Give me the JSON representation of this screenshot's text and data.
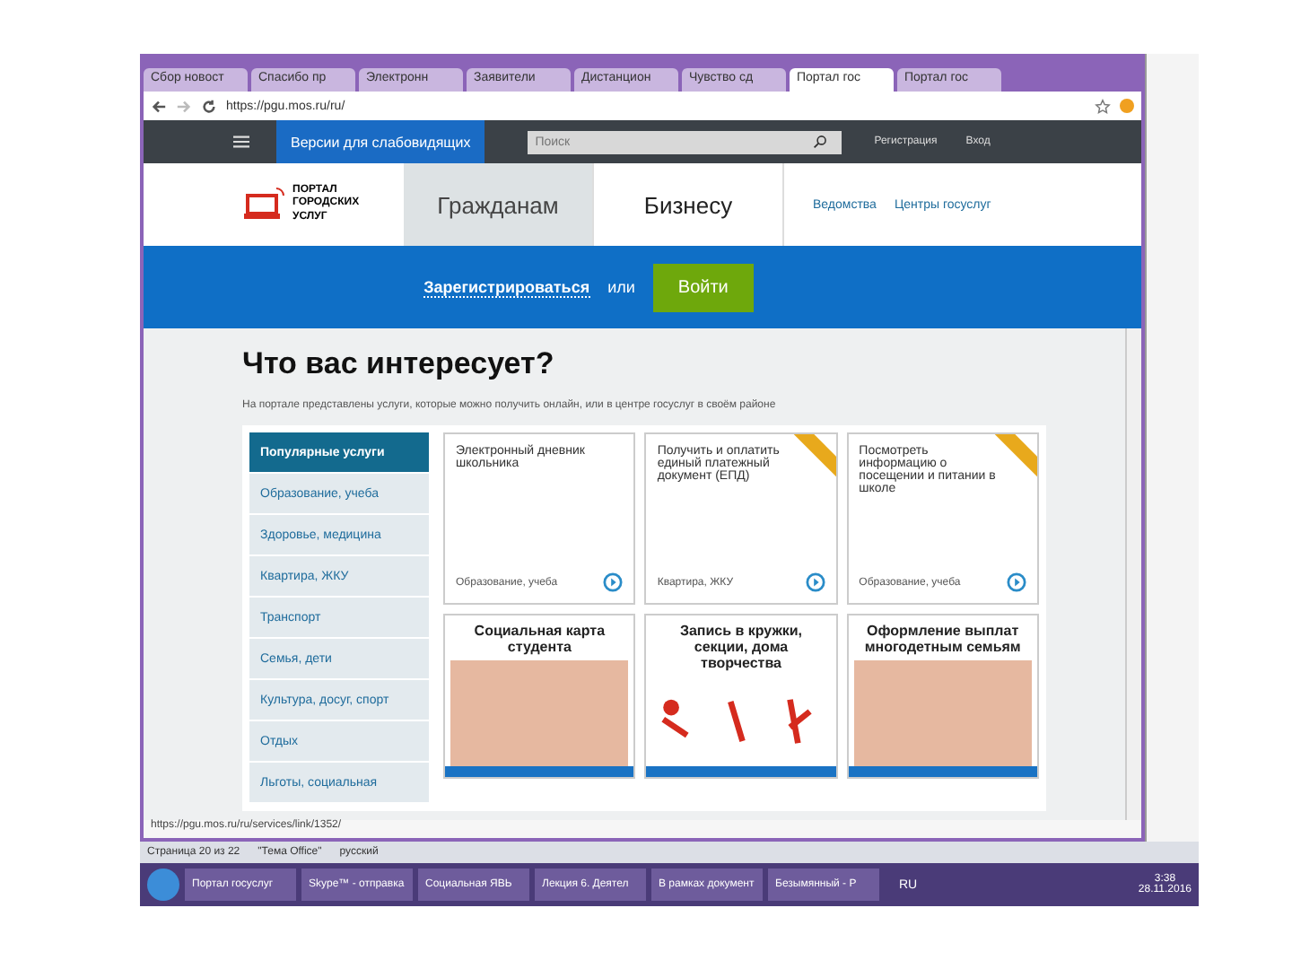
{
  "browser": {
    "tabs": [
      {
        "title": "Сбор новост",
        "selected": false
      },
      {
        "title": "Спасибо пр",
        "selected": false
      },
      {
        "title": "Электронн",
        "selected": false
      },
      {
        "title": "Заявители",
        "selected": false
      },
      {
        "title": "Дистанцион",
        "selected": false
      },
      {
        "title": "Чувство сд",
        "selected": false
      },
      {
        "title": "Портал гос",
        "selected": true
      },
      {
        "title": "Портал гос",
        "selected": false
      }
    ],
    "address": "https://pgu.mos.ru/ru/"
  },
  "site": {
    "accessibility_link": "Версии для слабовидящих",
    "search": {
      "placeholder": "Поиск"
    },
    "header_links": [
      "Регистрация",
      "Вход"
    ],
    "logo_text": "ПОРТАЛ ГОРОДСКИХ УСЛУГ",
    "audience_tabs": [
      {
        "label": "Гражданам",
        "selected": true
      },
      {
        "label": "Бизнесу",
        "selected": false
      }
    ],
    "nav_links": [
      "Ведомства",
      "Центры госуслуг"
    ],
    "register_link": "Зарегистрироваться",
    "or_text": "или",
    "login_button": "Войти",
    "heading": "Что вас интересует?",
    "subtitle": "На портале представлены услуги, которые можно получить онлайн, или в центре госуслуг в своём районе",
    "categories": [
      {
        "label": "Популярные услуги",
        "selected": true
      },
      {
        "label": "Образование, учеба",
        "selected": false
      },
      {
        "label": "Здоровье, медицина",
        "selected": false
      },
      {
        "label": "Квартира, ЖКУ",
        "selected": false
      },
      {
        "label": "Транспорт",
        "selected": false
      },
      {
        "label": "Семья, дети",
        "selected": false
      },
      {
        "label": "Культура, досуг, спорт",
        "selected": false
      },
      {
        "label": "Отдых",
        "selected": false
      },
      {
        "label": "Льготы, социальная",
        "selected": false
      }
    ],
    "service_cards": [
      {
        "title": "Электронный дневник школьника",
        "category": "Образование, учеба",
        "ribbon": false
      },
      {
        "title": "Получить и оплатить единый платежный документ (ЕПД)",
        "category": "Квартира, ЖКУ",
        "ribbon": true
      },
      {
        "title": "Посмотреть информацию о посещении и питании в школе",
        "category": "Образование, учеба",
        "ribbon": true
      }
    ],
    "featured_cards": [
      {
        "title": "Социальная карта студента",
        "kind": "people"
      },
      {
        "title": "Запись в кружки, секции, дома творчества",
        "kind": "sport"
      },
      {
        "title": "Оформление выплат многодетным семьям",
        "kind": "people"
      }
    ]
  },
  "browser_status": "https://pgu.mos.ru/ru/services/link/1352/",
  "word_status": [
    "Страница 20 из 22",
    "\"Тема Office\"",
    "русский"
  ],
  "taskbar": {
    "items": [
      "Портал госуслуг",
      "Skype™ - отправка",
      "Социальная ЯВЬ",
      "Лекция 6. Деятел",
      "В рамках документ",
      "Безымянный - Р"
    ],
    "language": "RU",
    "time": "3:38",
    "date": "28.11.2016"
  }
}
